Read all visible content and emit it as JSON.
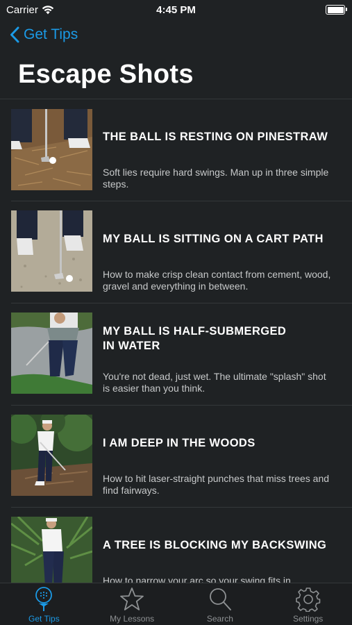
{
  "status_bar": {
    "carrier": "Carrier",
    "time": "4:45 PM",
    "wifi_icon": "wifi-icon",
    "battery_icon": "battery-icon"
  },
  "nav": {
    "back_label": "Get Tips",
    "back_icon": "chevron-left-icon",
    "title": "Escape Shots",
    "accent_color": "#1b9ae6"
  },
  "tips": [
    {
      "title": "THE BALL IS RESTING ON PINESTRAW",
      "description": "Soft lies require hard swings. Man up in three simple steps."
    },
    {
      "title": "MY BALL IS SITTING ON A CART PATH",
      "description": "How to make crisp clean contact from cement, wood, gravel and everything in between."
    },
    {
      "title_line1": "MY BALL IS HALF-SUBMERGED",
      "title_line2": "IN WATER",
      "description": "You're not dead, just wet. The ultimate \"splash\" shot is easier than you think."
    },
    {
      "title": "I AM DEEP IN THE WOODS",
      "description": "How to hit laser-straight punches that miss trees and find fairways."
    },
    {
      "title": "A TREE IS BLOCKING MY BACKSWING",
      "description": "How to narrow your arc so your swing fits in"
    }
  ],
  "tab_bar": {
    "tabs": [
      {
        "label": "Get Tips",
        "icon": "golf-ball-tee-icon",
        "active": true
      },
      {
        "label": "My Lessons",
        "icon": "star-icon",
        "active": false
      },
      {
        "label": "Search",
        "icon": "search-icon",
        "active": false
      },
      {
        "label": "Settings",
        "icon": "gear-icon",
        "active": false
      }
    ]
  },
  "colors": {
    "background": "#1f2224",
    "divider": "#34383a",
    "inactive_tab": "#8e9193"
  }
}
